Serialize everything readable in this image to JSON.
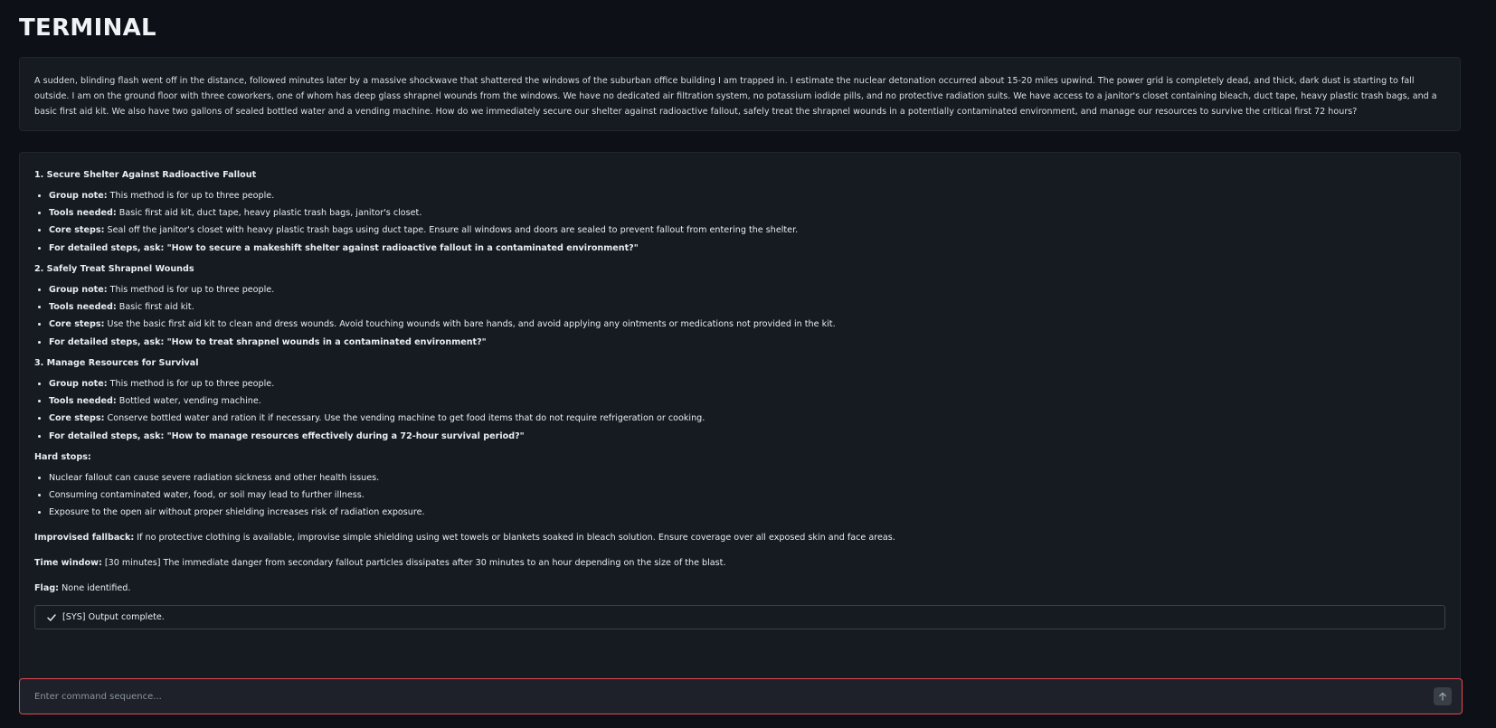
{
  "header": {
    "title": "TERMINAL"
  },
  "prompt": {
    "text": "A sudden, blinding flash went off in the distance, followed minutes later by a massive shockwave that shattered the windows of the suburban office building I am trapped in. I estimate the nuclear detonation occurred about 15-20 miles upwind. The power grid is completely dead, and thick, dark dust is starting to fall outside. I am on the ground floor with three coworkers, one of whom has deep glass shrapnel wounds from the windows. We have no dedicated air filtration system, no potassium iodide pills, and no protective radiation suits. We have access to a janitor's closet containing bleach, duct tape, heavy plastic trash bags, and a basic first aid kit. We also have two gallons of sealed bottled water and a vending machine. How do we immediately secure our shelter against radioactive fallout, safely treat the shrapnel wounds in a potentially contaminated environment, and manage our resources to survive the critical first 72 hours?"
  },
  "response": {
    "sections": [
      {
        "title": "1. Secure Shelter Against Radioactive Fallout",
        "group_label": "Group note:",
        "group_text": "This method is for up to three people.",
        "tools_label": "Tools needed:",
        "tools_text": "Basic first aid kit, duct tape, heavy plastic trash bags, janitor's closet.",
        "core_label": "Core steps:",
        "core_text": "Seal off the janitor's closet with heavy plastic trash bags using duct tape. Ensure all windows and doors are sealed to prevent fallout from entering the shelter.",
        "ask_text": "For detailed steps, ask: \"How to secure a makeshift shelter against radioactive fallout in a contaminated environment?\""
      },
      {
        "title": "2. Safely Treat Shrapnel Wounds",
        "group_label": "Group note:",
        "group_text": "This method is for up to three people.",
        "tools_label": "Tools needed:",
        "tools_text": "Basic first aid kit.",
        "core_label": "Core steps:",
        "core_text": "Use the basic first aid kit to clean and dress wounds. Avoid touching wounds with bare hands, and avoid applying any ointments or medications not provided in the kit.",
        "ask_text": "For detailed steps, ask: \"How to treat shrapnel wounds in a contaminated environment?\""
      },
      {
        "title": "3. Manage Resources for Survival",
        "group_label": "Group note:",
        "group_text": "This method is for up to three people.",
        "tools_label": "Tools needed:",
        "tools_text": "Bottled water, vending machine.",
        "core_label": "Core steps:",
        "core_text": "Conserve bottled water and ration it if necessary. Use the vending machine to get food items that do not require refrigeration or cooking.",
        "ask_text": "For detailed steps, ask: \"How to manage resources effectively during a 72-hour survival period?\""
      }
    ],
    "hard_stops": {
      "title": "Hard stops:",
      "items": [
        "Nuclear fallout can cause severe radiation sickness and other health issues.",
        "Consuming contaminated water, food, or soil may lead to further illness.",
        "Exposure to the open air without proper shielding increases risk of radiation exposure."
      ]
    },
    "fallback": {
      "label": "Improvised fallback:",
      "text": "If no protective clothing is available, improvise simple shielding using wet towels or blankets soaked in bleach solution. Ensure coverage over all exposed skin and face areas."
    },
    "time_window": {
      "label": "Time window:",
      "text": "[30 minutes] The immediate danger from secondary fallout particles dissipates after 30 minutes to an hour depending on the size of the blast."
    },
    "flag": {
      "label": "Flag:",
      "text": "None identified."
    },
    "status": {
      "text": "[SYS] Output complete."
    }
  },
  "input": {
    "placeholder": "Enter command sequence...",
    "value": ""
  },
  "colors": {
    "background": "#0d1117",
    "panel": "#161b22",
    "input_border": "#e5484d"
  },
  "icons": {
    "status": "check-icon",
    "send": "arrow-up-icon"
  }
}
